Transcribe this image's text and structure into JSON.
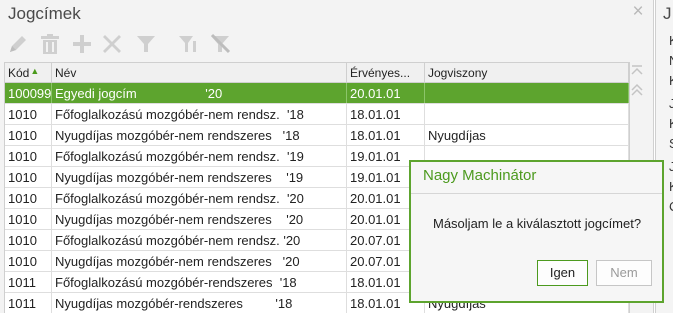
{
  "panel": {
    "title": "Jogcímek"
  },
  "toolbar": {
    "icons": [
      "edit-icon",
      "delete-icon",
      "add-icon",
      "tools-icon",
      "filter-icon",
      "filter-add-icon",
      "filter-clear-icon"
    ]
  },
  "table": {
    "columns": [
      "Kód",
      "Név",
      "Érvényes...",
      "Jogviszony"
    ],
    "rows": [
      {
        "kod": "100099",
        "nev": "Egyedi jogcím                   '20",
        "ervenyes": "20.01.01",
        "jogviszony": ""
      },
      {
        "kod": "1010",
        "nev": "Főfoglalkozású mozgóbér-nem rendsz.  '18",
        "ervenyes": "18.01.01",
        "jogviszony": ""
      },
      {
        "kod": "1010",
        "nev": "Nyugdíjas mozgóbér-nem rendszeres   '18",
        "ervenyes": "18.01.01",
        "jogviszony": "Nyugdíjas"
      },
      {
        "kod": "1010",
        "nev": "Főfoglalkozású mozgóbér-nem rendsz.  '19",
        "ervenyes": "19.01.01",
        "jogviszony": ""
      },
      {
        "kod": "1010",
        "nev": "Nyugdíjas mozgóbér-nem rendszeres    '19",
        "ervenyes": "19.01.01",
        "jogviszony": ""
      },
      {
        "kod": "1010",
        "nev": "Főfoglalkozású mozgóbér-nem rendsz.  '20",
        "ervenyes": "20.01.01",
        "jogviszony": ""
      },
      {
        "kod": "1010",
        "nev": "Nyugdíjas mozgóbér-nem rendszeres    '20",
        "ervenyes": "20.01.01",
        "jogviszony": ""
      },
      {
        "kod": "1010",
        "nev": "Főfoglalkozású mozgóbér-nem rendsz. '20",
        "ervenyes": "20.07.01",
        "jogviszony": ""
      },
      {
        "kod": "1010",
        "nev": "Nyugdíjas mozgóbér-nem rendszeres   '20",
        "ervenyes": "20.07.01",
        "jogviszony": ""
      },
      {
        "kod": "1011",
        "nev": "Főfoglalkozású mozgóbér-rendszeres  '18",
        "ervenyes": "18.01.01",
        "jogviszony": ""
      },
      {
        "kod": "1011",
        "nev": "Nyugdíjas mozgóbér-rendszeres         '18",
        "ervenyes": "18.01.01",
        "jogviszony": "Nyugdíjas"
      }
    ],
    "selected_index": 0
  },
  "side_panel": {
    "title": "J",
    "letters": [
      "K",
      "N",
      "K",
      "J",
      "K",
      "S",
      "J",
      "K",
      "C"
    ]
  },
  "dialog": {
    "title": "Nagy Machinátor",
    "message": "Másoljam le a kiválasztott jogcímet?",
    "yes_label": "Igen",
    "no_label": "Nem"
  },
  "colors": {
    "accent": "#5da42e",
    "accent_text": "#4c9a1e"
  }
}
